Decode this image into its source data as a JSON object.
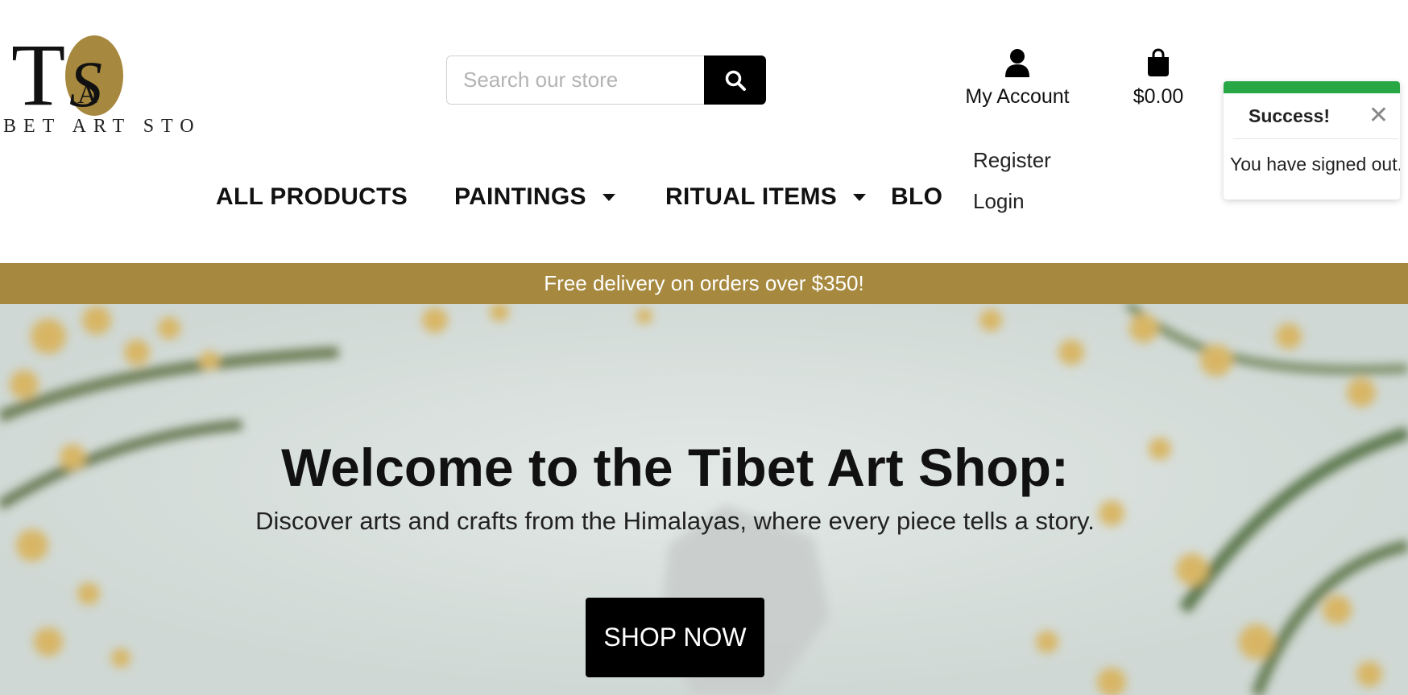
{
  "brand": {
    "logo_monogram": "TAS",
    "logo_text": "BET ART STORE",
    "logo_circle_color": "#a6893e"
  },
  "search": {
    "placeholder": "Search our store",
    "button_icon": "search-icon"
  },
  "account": {
    "label": "My Account",
    "icon": "user-icon",
    "menu": [
      {
        "label": "Register"
      },
      {
        "label": "Login"
      }
    ]
  },
  "cart": {
    "total": "$0.00",
    "icon": "shopping-bag-icon"
  },
  "nav": {
    "items": [
      {
        "label": "ALL PRODUCTS",
        "dropdown": false
      },
      {
        "label": "PAINTINGS",
        "dropdown": true
      },
      {
        "label": "RITUAL ITEMS",
        "dropdown": true
      },
      {
        "label": "BLOG",
        "dropdown": false
      }
    ]
  },
  "banner": {
    "text": "Free delivery on orders over $350!",
    "color": "#a6893e"
  },
  "hero": {
    "title": "Welcome to the Tibet Art Shop:",
    "subtitle": "Discover arts and crafts from the Himalayas, where every piece tells a story.",
    "cta_label": "SHOP NOW"
  },
  "toast": {
    "title": "Success!",
    "message": "You have signed out.",
    "close_icon": "close-icon",
    "accent_color": "#28a745"
  }
}
